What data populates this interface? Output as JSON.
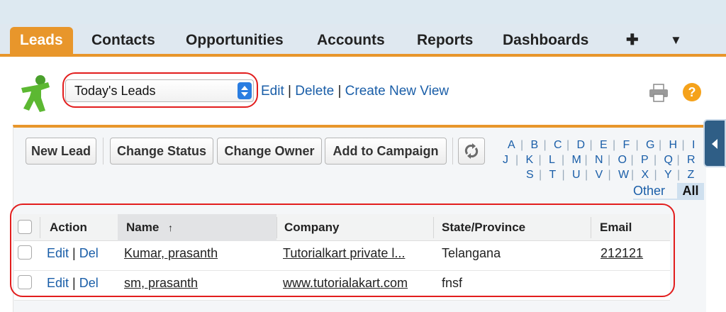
{
  "tabs": [
    {
      "label": "Leads",
      "active": true
    },
    {
      "label": "Contacts"
    },
    {
      "label": "Opportunities"
    },
    {
      "label": "Accounts"
    },
    {
      "label": "Reports"
    },
    {
      "label": "Dashboards"
    },
    {
      "label": "✚"
    },
    {
      "label": "▼"
    }
  ],
  "view": {
    "selected": "Today's Leads",
    "edit": "Edit",
    "delete": "Delete",
    "create": "Create New View",
    "sep": "|"
  },
  "toolbar": {
    "new_lead": "New Lead",
    "change_status": "Change Status",
    "change_owner": "Change Owner",
    "add_to_campaign": "Add to Campaign"
  },
  "alphabet": {
    "row1": [
      "A",
      "B",
      "C",
      "D",
      "E",
      "F",
      "G",
      "H",
      "I"
    ],
    "row2": [
      "J",
      "K",
      "L",
      "M",
      "N",
      "O",
      "P",
      "Q",
      "R"
    ],
    "row3": [
      "S",
      "T",
      "U",
      "V",
      "W",
      "X",
      "Y",
      "Z"
    ],
    "other": "Other",
    "all": "All"
  },
  "table": {
    "headers": {
      "action": "Action",
      "name": "Name",
      "sort": "↑",
      "company": "Company",
      "state": "State/Province",
      "email": "Email"
    },
    "rows": [
      {
        "edit": "Edit",
        "sep": "|",
        "del": "Del",
        "name": "Kumar, prasanth",
        "company": "Tutorialkart private l...",
        "state": "Telangana",
        "email": "212121"
      },
      {
        "edit": "Edit",
        "sep": "|",
        "del": "Del",
        "name": "sm, prasanth",
        "company": "www.tutorialakart.com",
        "state": "fnsf",
        "email": ""
      }
    ]
  },
  "colors": {
    "accent": "#e8962b",
    "link": "#1a5ea8",
    "highlight": "#e21d1d"
  },
  "icons": {
    "logo": "leads-person-icon",
    "print": "printer-icon",
    "help": "help-icon",
    "refresh": "refresh-icon"
  },
  "help_glyph": "?"
}
